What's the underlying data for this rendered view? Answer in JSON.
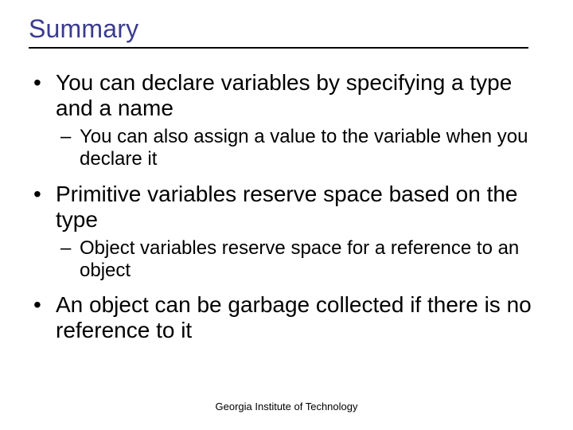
{
  "title": "Summary",
  "bullets": [
    {
      "text": "You can declare variables by specifying a type and a name",
      "sub": [
        "You can also assign a value to the variable when you declare it"
      ]
    },
    {
      "text": "Primitive variables reserve space based on the type",
      "sub": [
        "Object variables reserve space for a reference to an object"
      ]
    },
    {
      "text": "An object can be garbage collected if there is no reference to it",
      "sub": []
    }
  ],
  "footer": "Georgia Institute of Technology"
}
